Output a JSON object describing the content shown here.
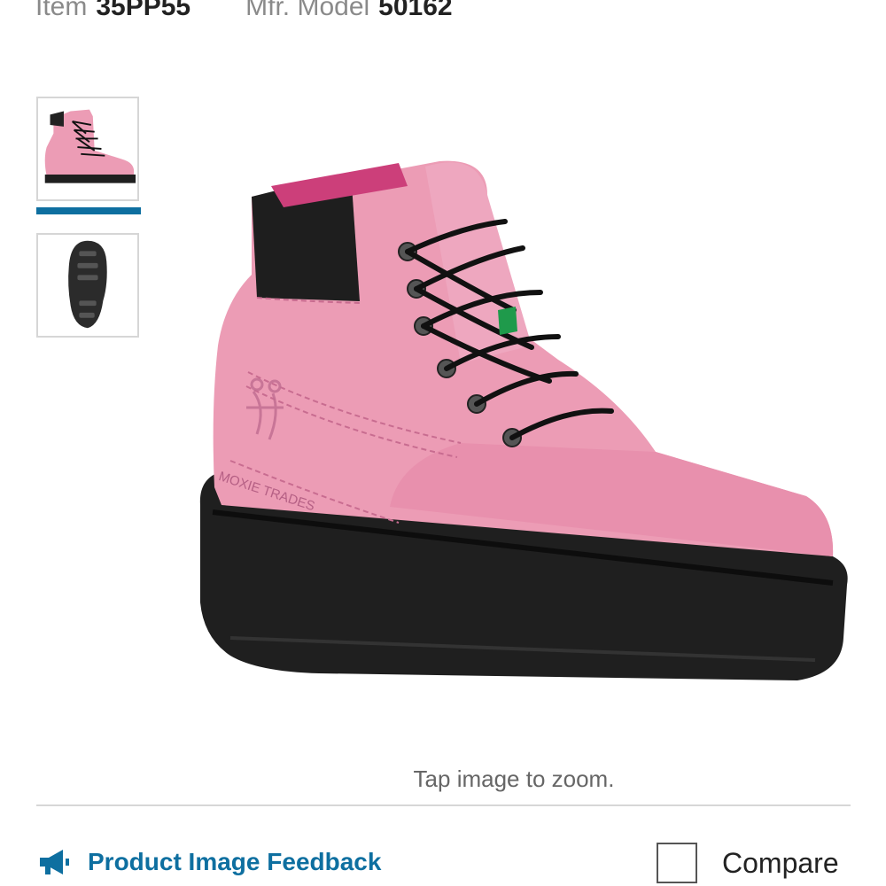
{
  "header": {
    "item_label": "Item",
    "item_value": "35PP55",
    "model_label": "Mfr. Model",
    "model_value": "50162"
  },
  "gallery": {
    "thumbnails": [
      {
        "name": "boot-side-view",
        "selected": true
      },
      {
        "name": "boot-sole-view",
        "selected": false
      }
    ],
    "main_image": "pink-work-boot",
    "zoom_hint": "Tap image to zoom.",
    "logo_text": "MOXIE TRADES"
  },
  "footer": {
    "feedback_label": "Product Image Feedback",
    "feedback_icon": "megaphone-icon",
    "compare_label": "Compare",
    "compare_checked": false
  },
  "colors": {
    "accent": "#0e6fa0",
    "boot_pink": "#ec9cb5",
    "sole_black": "#1f1f1f"
  }
}
